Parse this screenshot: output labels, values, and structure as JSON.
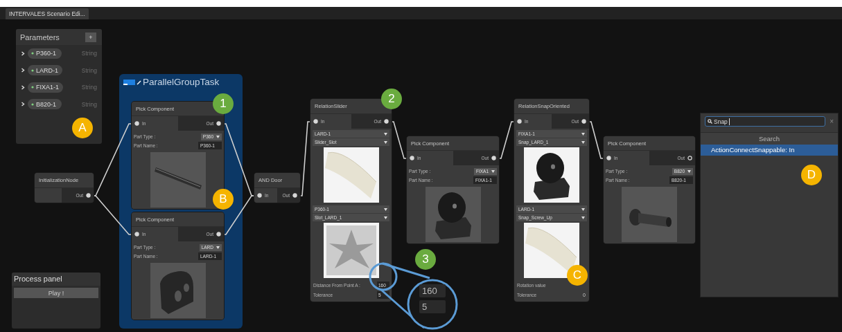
{
  "tab": {
    "title": "INTERVALES Scenario Edi..."
  },
  "parameters_panel": {
    "title": "Parameters",
    "add_button": "+",
    "items": [
      {
        "name": "P360-1",
        "type": "String",
        "expanded": false
      },
      {
        "name": "LARD-1",
        "type": "String",
        "expanded": false
      },
      {
        "name": "FIXA1-1",
        "type": "String",
        "expanded": false
      },
      {
        "name": "B820-1",
        "type": "String",
        "expanded": false
      }
    ]
  },
  "process_panel": {
    "title": "Process panel",
    "play_button": "Play !"
  },
  "group": {
    "title": "ParallelGroupTask",
    "nodes": [
      {
        "kind": "pick",
        "title": "Pick Component",
        "in": {
          "label": "In",
          "connected": true
        },
        "out": {
          "label": "Out",
          "connected": true
        },
        "part_type_label": "Part Type :",
        "part_type": "P360",
        "part_name_label": "Part Name :",
        "part_name": "P360-1",
        "preview": {
          "kind": "rod"
        }
      },
      {
        "kind": "pick",
        "title": "Pick Component",
        "in": {
          "label": "In",
          "connected": true
        },
        "out": {
          "label": "Out",
          "connected": true
        },
        "part_type_label": "Part Type :",
        "part_type": "LARD",
        "part_name_label": "Part Name :",
        "part_name": "LARD-1",
        "preview": {
          "kind": "block"
        }
      }
    ]
  },
  "nodes": [
    {
      "kind": "init",
      "title": "InitializationNode",
      "out": {
        "label": "Out",
        "connected": true
      }
    },
    {
      "kind": "gate",
      "title": "AND Door",
      "in": {
        "label": "In",
        "connected": true
      },
      "out": {
        "label": "Out",
        "connected": true
      }
    },
    {
      "kind": "relation",
      "title": "RelationSlider",
      "in": {
        "label": "In",
        "connected": true
      },
      "out": {
        "label": "Out",
        "connected": true
      },
      "sections": [
        {
          "kind": "select",
          "value": "LARD-1"
        },
        {
          "kind": "select",
          "value": "Slider_Slot"
        },
        {
          "kind": "preview",
          "image": {
            "kind": "slider"
          }
        },
        {
          "kind": "select",
          "value": "P360-1"
        },
        {
          "kind": "select",
          "value": "Slot_LARD_1"
        },
        {
          "kind": "preview",
          "image": {
            "kind": "star"
          }
        },
        {
          "kind": "field",
          "label": "Distance From Point A :",
          "value": "160"
        },
        {
          "kind": "field",
          "label": "Tolerance",
          "value": "5"
        }
      ]
    },
    {
      "kind": "pick",
      "title": "Pick Component",
      "in": {
        "label": "In",
        "connected": true
      },
      "out": {
        "label": "Out",
        "connected": true
      },
      "part_type_label": "Part Type :",
      "part_type": "FIXA1",
      "part_name_label": "Part Name :",
      "part_name": "FIXA1-1",
      "preview": {
        "kind": "wheel"
      }
    },
    {
      "kind": "relation",
      "title": "RelationSnapOriented",
      "in": {
        "label": "In",
        "connected": true
      },
      "out": {
        "label": "Out",
        "connected": true
      },
      "sections": [
        {
          "kind": "select",
          "value": "FIXA1-1"
        },
        {
          "kind": "select",
          "value": "Snap_LARD_1"
        },
        {
          "kind": "preview",
          "image": {
            "kind": "wheel"
          }
        },
        {
          "kind": "select",
          "value": "LARD-1"
        },
        {
          "kind": "select",
          "value": "Snap_Screw_Up"
        },
        {
          "kind": "preview",
          "image": {
            "kind": "slider"
          }
        },
        {
          "kind": "field",
          "label": "Rotation value"
        },
        {
          "kind": "number",
          "label": "Tolerance",
          "value": "0"
        }
      ]
    },
    {
      "kind": "pick",
      "title": "Pick Component",
      "in": {
        "label": "In",
        "connected": true
      },
      "out": {
        "label": "Out",
        "connected": false
      },
      "part_type_label": "Part Type :",
      "part_type": "B820",
      "part_name_label": "Part Name :",
      "part_name": "B820-1",
      "preview": {
        "kind": "bolt"
      }
    }
  ],
  "magnifier": {
    "values": [
      "160",
      "5"
    ]
  },
  "search_popup": {
    "query": "Snap",
    "clear_button": "×",
    "header": "Search",
    "results": [
      {
        "label": "ActionConnectSnappable: In",
        "selected": true
      }
    ]
  },
  "callouts": [
    {
      "label": "A",
      "color": "#f5b400"
    },
    {
      "label": "1",
      "color": "#6aab3f"
    },
    {
      "label": "B",
      "color": "#f5b400"
    },
    {
      "label": "2",
      "color": "#6aab3f"
    },
    {
      "label": "3",
      "color": "#6aab3f"
    },
    {
      "label": "C",
      "color": "#f5b400"
    },
    {
      "label": "D",
      "color": "#f5b400"
    }
  ]
}
